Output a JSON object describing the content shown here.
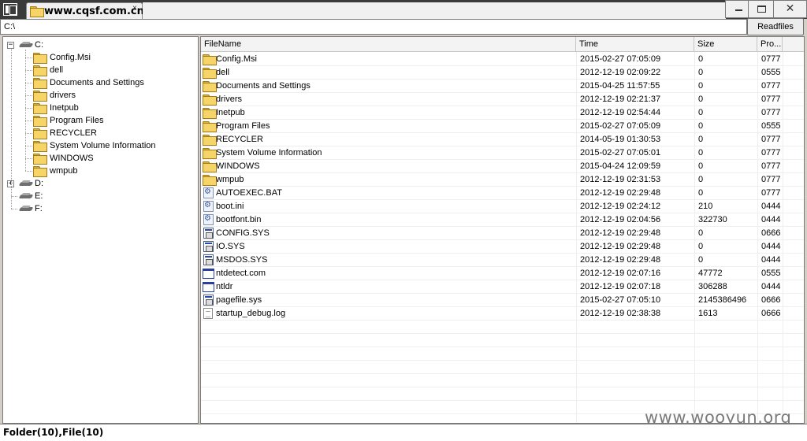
{
  "window": {
    "tab_title": "www.cqsf.com.cn",
    "tab_close": "×",
    "minimize": "",
    "maximize": "",
    "close": "✕"
  },
  "address": {
    "path": "C:\\"
  },
  "toolbar": {
    "readfiles_label": "Readfiles"
  },
  "tree": {
    "drives": [
      {
        "label": "C:",
        "expanded": true
      },
      {
        "label": "D:",
        "expanded": false,
        "has_children": true
      },
      {
        "label": "E:",
        "expanded": false,
        "has_children": false
      },
      {
        "label": "F:",
        "expanded": false,
        "has_children": false
      }
    ],
    "c_children": [
      "Config.Msi",
      "dell",
      "Documents and Settings",
      "drivers",
      "Inetpub",
      "Program Files",
      "RECYCLER",
      "System Volume Information",
      "WINDOWS",
      "wmpub"
    ]
  },
  "list": {
    "columns": [
      "FileName",
      "Time",
      "Size",
      "Pro..."
    ],
    "rows": [
      {
        "name": "Config.Msi",
        "time": "2015-02-27 07:05:09",
        "size": "0",
        "prop": "0777",
        "icon": "folder-icon"
      },
      {
        "name": "dell",
        "time": "2012-12-19 02:09:22",
        "size": "0",
        "prop": "0555",
        "icon": "folder-icon"
      },
      {
        "name": "Documents and Settings",
        "time": "2015-04-25 11:57:55",
        "size": "0",
        "prop": "0777",
        "icon": "folder-icon"
      },
      {
        "name": "drivers",
        "time": "2012-12-19 02:21:37",
        "size": "0",
        "prop": "0777",
        "icon": "folder-icon"
      },
      {
        "name": "Inetpub",
        "time": "2012-12-19 02:54:44",
        "size": "0",
        "prop": "0777",
        "icon": "folder-icon"
      },
      {
        "name": "Program Files",
        "time": "2015-02-27 07:05:09",
        "size": "0",
        "prop": "0555",
        "icon": "folder-icon"
      },
      {
        "name": "RECYCLER",
        "time": "2014-05-19 01:30:53",
        "size": "0",
        "prop": "0777",
        "icon": "folder-icon"
      },
      {
        "name": "System Volume Information",
        "time": "2015-02-27 07:05:01",
        "size": "0",
        "prop": "0777",
        "icon": "folder-icon"
      },
      {
        "name": "WINDOWS",
        "time": "2015-04-24 12:09:59",
        "size": "0",
        "prop": "0777",
        "icon": "folder-icon"
      },
      {
        "name": "wmpub",
        "time": "2012-12-19 02:31:53",
        "size": "0",
        "prop": "0777",
        "icon": "folder-icon"
      },
      {
        "name": "AUTOEXEC.BAT",
        "time": "2012-12-19 02:29:48",
        "size": "0",
        "prop": "0777",
        "icon": "batch-file-icon"
      },
      {
        "name": "boot.ini",
        "time": "2012-12-19 02:24:12",
        "size": "210",
        "prop": "0444",
        "icon": "settings-file-icon"
      },
      {
        "name": "bootfont.bin",
        "time": "2012-12-19 02:04:56",
        "size": "322730",
        "prop": "0444",
        "icon": "settings-file-icon"
      },
      {
        "name": "CONFIG.SYS",
        "time": "2012-12-19 02:29:48",
        "size": "0",
        "prop": "0666",
        "icon": "system-file-icon"
      },
      {
        "name": "IO.SYS",
        "time": "2012-12-19 02:29:48",
        "size": "0",
        "prop": "0444",
        "icon": "system-file-icon"
      },
      {
        "name": "MSDOS.SYS",
        "time": "2012-12-19 02:29:48",
        "size": "0",
        "prop": "0444",
        "icon": "system-file-icon"
      },
      {
        "name": "ntdetect.com",
        "time": "2012-12-19 02:07:16",
        "size": "47772",
        "prop": "0555",
        "icon": "executable-icon"
      },
      {
        "name": "ntldr",
        "time": "2012-12-19 02:07:18",
        "size": "306288",
        "prop": "0444",
        "icon": "executable-icon"
      },
      {
        "name": "pagefile.sys",
        "time": "2015-02-27 07:05:10",
        "size": "2145386496",
        "prop": "0666",
        "icon": "system-file-icon"
      },
      {
        "name": "startup_debug.log",
        "time": "2012-12-19 02:38:38",
        "size": "1613",
        "prop": "0666",
        "icon": "text-file-icon"
      }
    ]
  },
  "status": {
    "text": "Folder(10),File(10)"
  },
  "watermark": "www.wooyun.org"
}
